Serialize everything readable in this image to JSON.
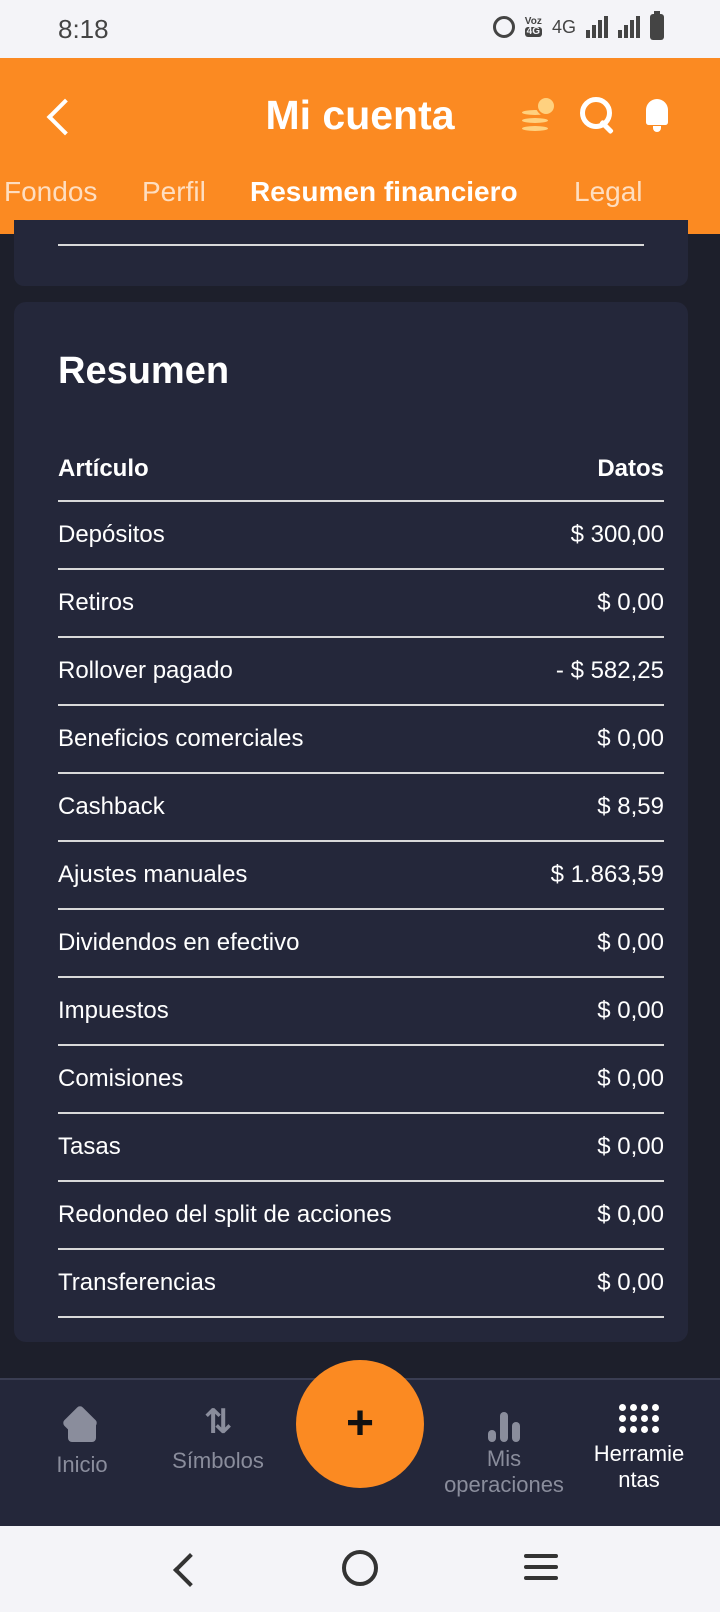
{
  "status_bar": {
    "time": "8:18",
    "volte_top": "Voz",
    "volte_bottom": "4G",
    "network": "4G"
  },
  "header": {
    "title": "Mi cuenta",
    "back_icon": "back-arrow-icon",
    "icons": [
      "coins-icon",
      "search-icon",
      "bell-icon"
    ],
    "accent_color": "#fb8a22"
  },
  "tabs": [
    {
      "label": "Fondos",
      "active": false
    },
    {
      "label": "Perfil",
      "active": false
    },
    {
      "label": "Resumen financiero",
      "active": true
    },
    {
      "label": "Legal",
      "active": false
    }
  ],
  "summary": {
    "title": "Resumen",
    "columns": {
      "item": "Artículo",
      "data": "Datos"
    },
    "rows": [
      {
        "label": "Depósitos",
        "value": "$ 300,00"
      },
      {
        "label": "Retiros",
        "value": "$ 0,00"
      },
      {
        "label": "Rollover pagado",
        "value": "- $ 582,25"
      },
      {
        "label": "Beneficios comerciales",
        "value": "$ 0,00"
      },
      {
        "label": "Cashback",
        "value": "$ 8,59"
      },
      {
        "label": "Ajustes manuales",
        "value": "$ 1.863,59"
      },
      {
        "label": "Dividendos en efectivo",
        "value": "$ 0,00"
      },
      {
        "label": "Impuestos",
        "value": "$ 0,00"
      },
      {
        "label": "Comisiones",
        "value": "$ 0,00"
      },
      {
        "label": "Tasas",
        "value": "$ 0,00"
      },
      {
        "label": "Redondeo del split de acciones",
        "value": "$ 0,00"
      },
      {
        "label": "Transferencias",
        "value": "$ 0,00"
      }
    ]
  },
  "bottom_nav": {
    "home": "Inicio",
    "symbols": "Símbolos",
    "my_trades_1": "Mis",
    "my_trades_2": "operaciones",
    "tools_1": "Herramie",
    "tools_2": "ntas",
    "fab_icon": "plus-icon"
  },
  "system_nav": [
    "back-icon",
    "home-circle-icon",
    "menu-icon"
  ]
}
